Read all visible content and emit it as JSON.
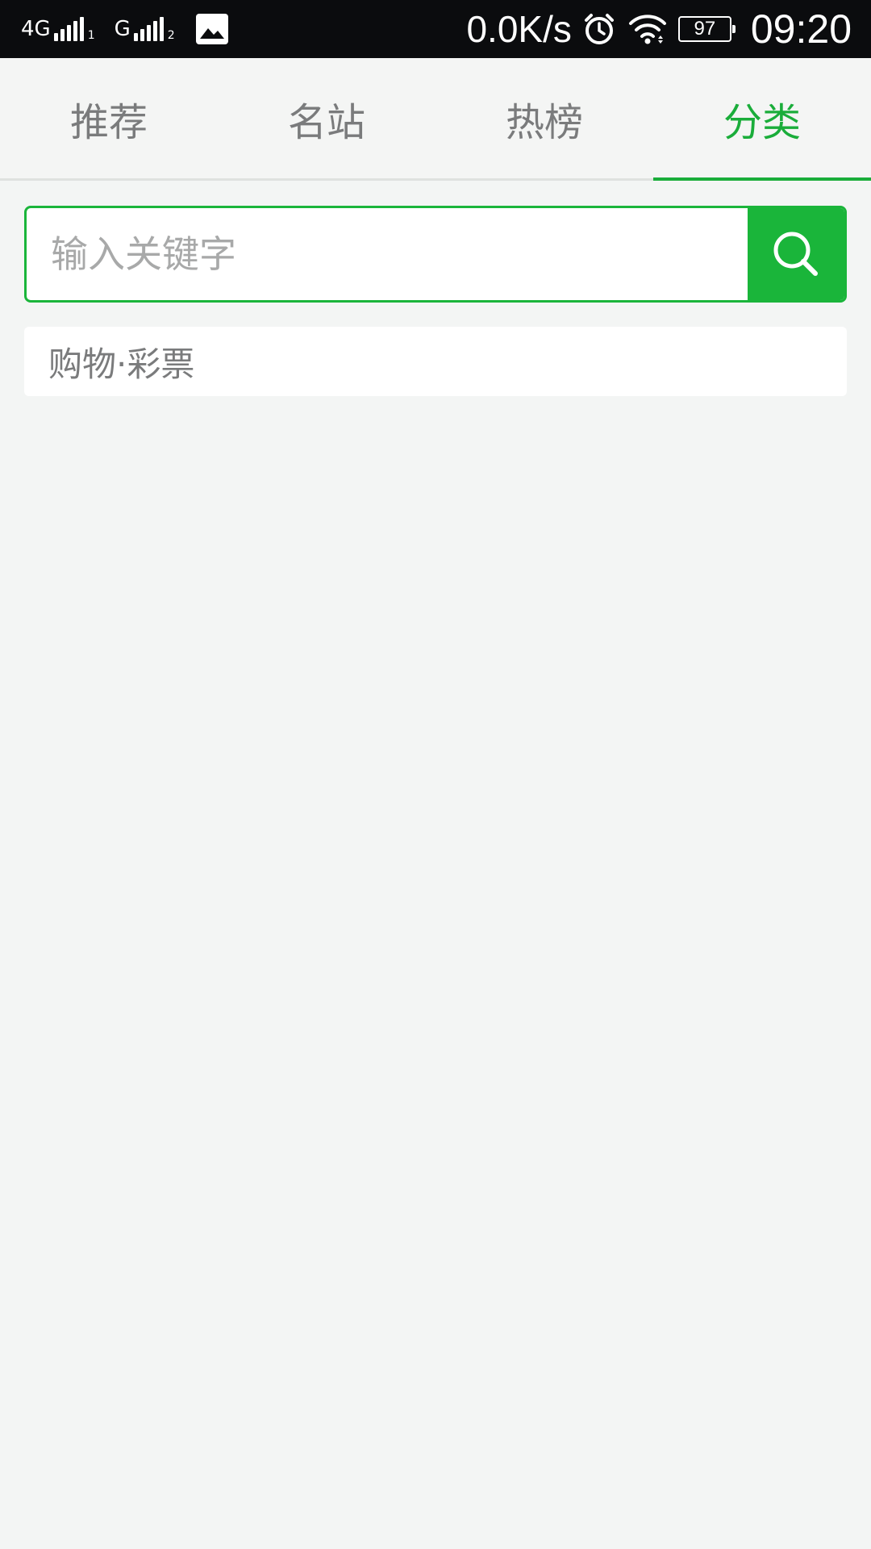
{
  "status_bar": {
    "sim1_network": "4G",
    "sim1_slot": "1",
    "sim2_network": "G",
    "sim2_slot": "2",
    "net_speed": "0.0K/s",
    "battery_level": "97",
    "time": "09:20",
    "icons": [
      "signal-icon",
      "image-notification-icon",
      "alarm-icon",
      "wifi-icon",
      "battery-icon"
    ]
  },
  "tabs": [
    {
      "label": "推荐",
      "active": false
    },
    {
      "label": "名站",
      "active": false
    },
    {
      "label": "热榜",
      "active": false
    },
    {
      "label": "分类",
      "active": true
    }
  ],
  "search": {
    "placeholder": "输入关键字",
    "value": "",
    "button_icon": "search-icon"
  },
  "categories": [
    {
      "label": "购物·彩票"
    }
  ],
  "colors": {
    "accent": "#1aad3a",
    "status_bar_bg": "#0b0c0e",
    "page_bg": "#f3f5f4",
    "inactive_text": "#7a7b7c"
  }
}
